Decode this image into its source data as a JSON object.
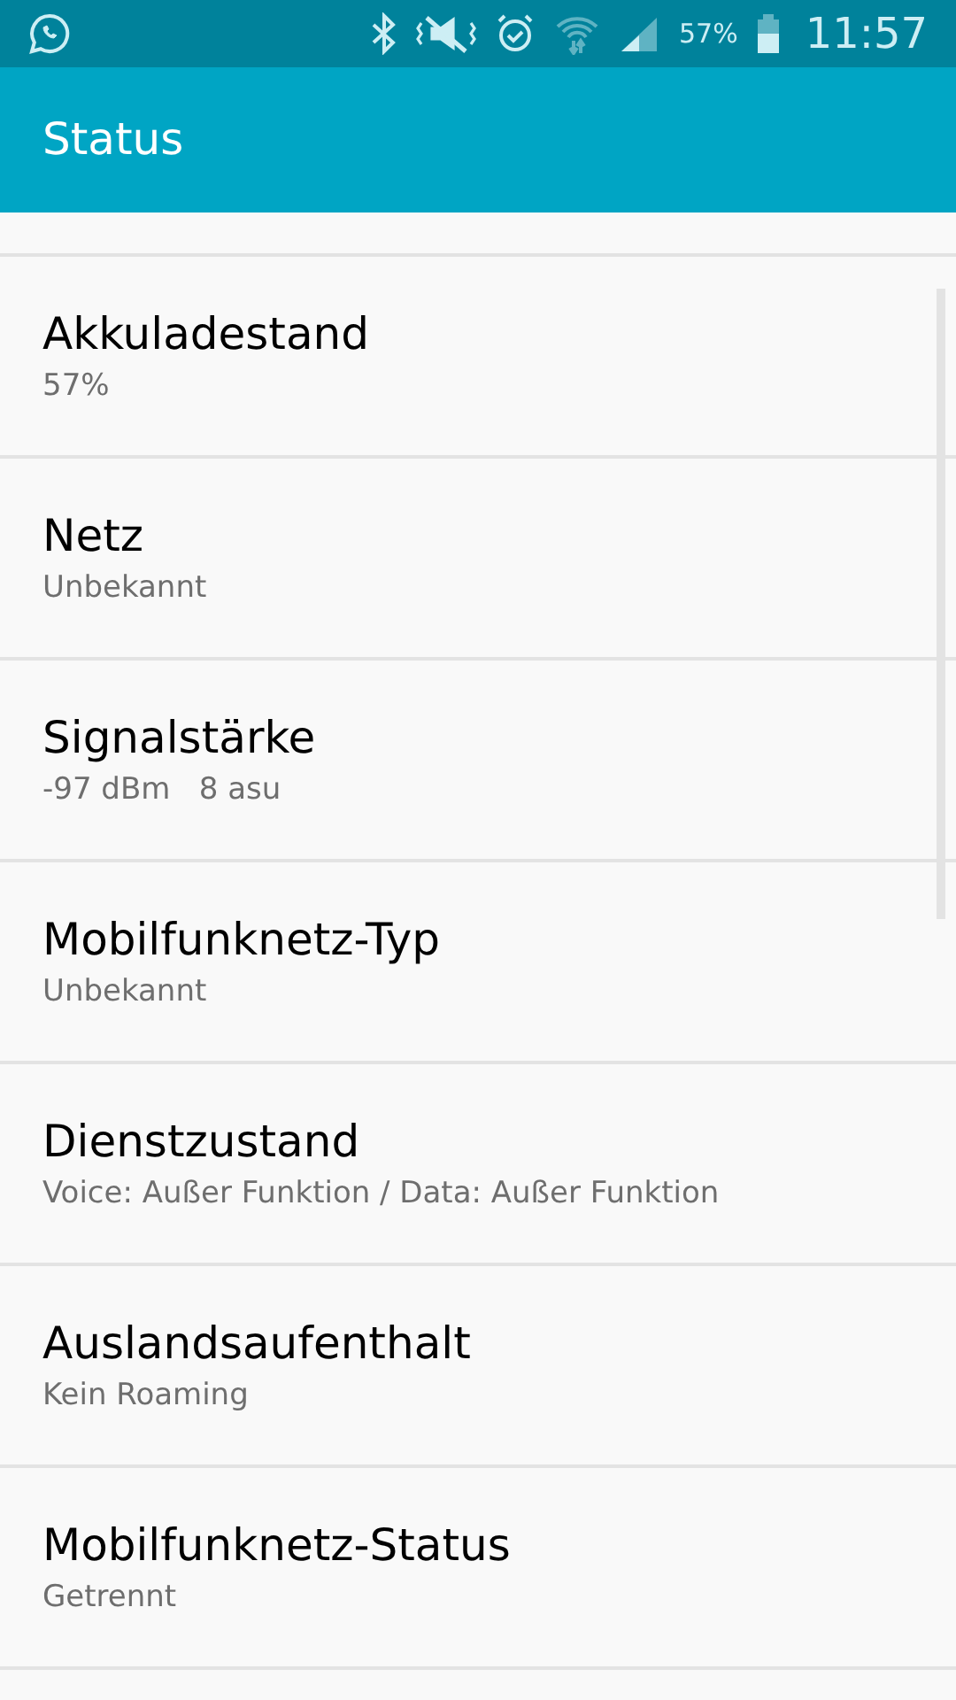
{
  "status_bar": {
    "battery_text": "57%",
    "time": "11:57"
  },
  "app_bar": {
    "title": "Status"
  },
  "items": [
    {
      "title": "Akkuladestand",
      "value": "57%"
    },
    {
      "title": "Netz",
      "value": "Unbekannt"
    },
    {
      "title": "Signalstärke",
      "value": "-97 dBm   8 asu"
    },
    {
      "title": "Mobilfunknetz-Typ",
      "value": "Unbekannt"
    },
    {
      "title": "Dienstzustand",
      "value": "Voice: Außer Funktion / Data: Außer Funktion"
    },
    {
      "title": "Auslandsaufenthalt",
      "value": "Kein Roaming"
    },
    {
      "title": "Mobilfunknetz-Status",
      "value": "Getrennt"
    }
  ]
}
